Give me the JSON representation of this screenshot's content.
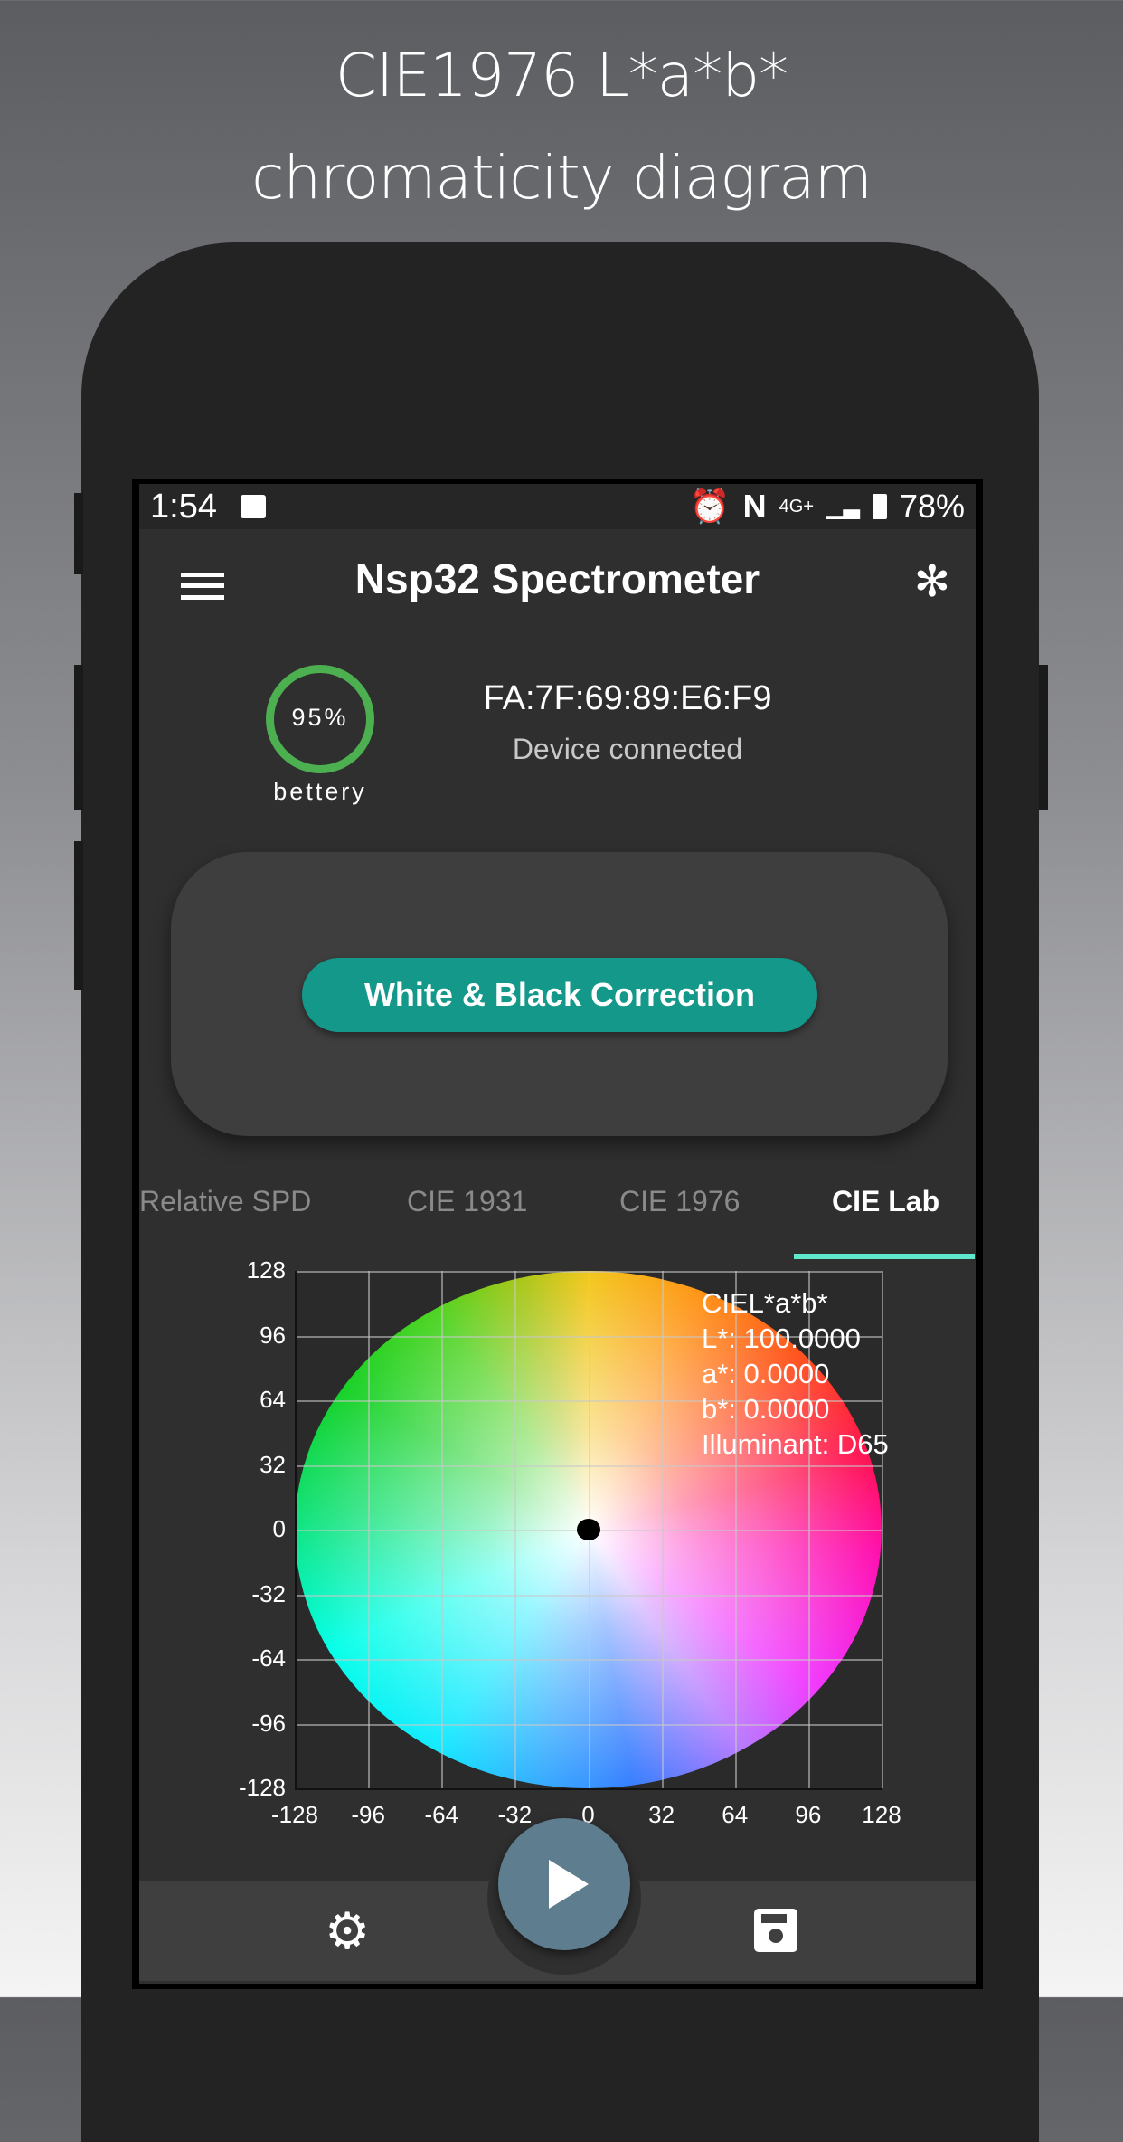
{
  "headline": {
    "line1": "CIE1976 L*a*b*",
    "line2": "chromaticity diagram"
  },
  "status_bar": {
    "time": "1:54",
    "network": "4G+",
    "battery": "78%",
    "icons": [
      "image-icon",
      "alarm-icon",
      "nfc-icon",
      "signal-icon",
      "battery-icon"
    ]
  },
  "app_bar": {
    "title": "Nsp32 Spectrometer",
    "menu_icon": "menu-icon",
    "bluetooth_icon": "bluetooth-icon"
  },
  "device": {
    "battery_percent": "95%",
    "battery_level": 95,
    "battery_label": "bettery",
    "mac": "FA:7F:69:89:E6:F9",
    "status": "Device connected"
  },
  "correction_button": "White & Black Correction",
  "tabs": [
    {
      "label": "Relative SPD"
    },
    {
      "label": "CIE 1931"
    },
    {
      "label": "CIE 1976"
    },
    {
      "label": "CIE Lab",
      "active": true
    }
  ],
  "colors": {
    "accent": "#13988a",
    "tab_indicator": "#5ee8cc",
    "battery_ring": "#4caf50",
    "fab": "#5e7d8e"
  },
  "chart_data": {
    "type": "scatter",
    "xlim": [
      -128,
      128
    ],
    "ylim": [
      -128,
      128
    ],
    "grid": true,
    "x_ticks": [
      "-128",
      "-96",
      "-64",
      "-32",
      "0",
      "32",
      "64",
      "96",
      "128"
    ],
    "y_ticks": [
      "128",
      "96",
      "64",
      "32",
      "0",
      "-32",
      "-64",
      "-96",
      "-128"
    ],
    "points": [
      {
        "a": 0,
        "b": 0
      }
    ],
    "annotation": [
      "CIEL*a*b*",
      "L*: 100.0000",
      "a*: 0.0000",
      "b*: 0.0000",
      "Illuminant: D65"
    ]
  },
  "bottom_nav": {
    "play_icon": "play-icon",
    "settings_icon": "gear-icon",
    "save_icon": "save-icon"
  }
}
